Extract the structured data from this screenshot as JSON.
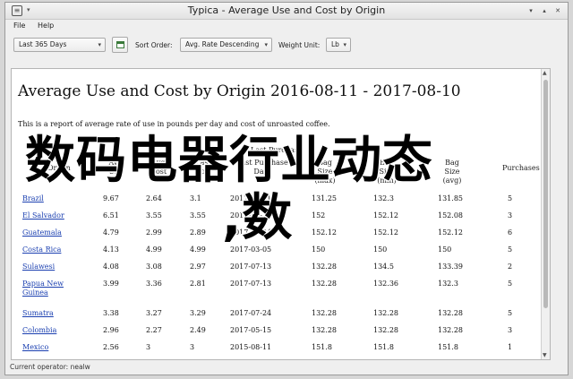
{
  "window": {
    "title": "Typica - Average Use and Cost by Origin",
    "icon": "app-icon",
    "controls": [
      "minimize-icon",
      "maximize-icon",
      "close-icon"
    ]
  },
  "menu": {
    "file": "File",
    "help": "Help"
  },
  "toolbar": {
    "date_range": "Last 365 Days",
    "sort_label": "Sort Order:",
    "sort_value": "Avg. Rate Descending",
    "weight_label": "Weight Unit:",
    "weight_value": "Lb"
  },
  "report": {
    "title": "Average Use and Cost by Origin 2016-08-11 - 2017-08-10",
    "description": "This is a report of average rate of use in pounds per day and cost of unroasted coffee.",
    "headers": {
      "origin": "Origin",
      "avg_use": "Avg Use",
      "avg_cost": "Avg Cost",
      "last_cost": "Last Cost",
      "group": "Last Purchase",
      "purchase_date": "Last Purchase Date",
      "bag_size": "Bag Size (max)",
      "bag_size_min": "Bag Size (min)",
      "bag_size_avg": "Bag Size (avg)",
      "purchases": "Purchases"
    },
    "rows": [
      {
        "origin": "Brazil",
        "use": "9.67",
        "cost": "2.64",
        "last": "3.1",
        "date": "2017-06-11",
        "max": "131.25",
        "min": "132.3",
        "avg": "131.85",
        "n": "5"
      },
      {
        "origin": "El Salvador",
        "use": "6.51",
        "cost": "3.55",
        "last": "3.55",
        "date": "2016-12-14",
        "max": "152",
        "min": "152.12",
        "avg": "152.08",
        "n": "3"
      },
      {
        "origin": "Guatemala",
        "use": "4.79",
        "cost": "2.99",
        "last": "2.89",
        "date": "2017-06-24",
        "max": "152.12",
        "min": "152.12",
        "avg": "152.12",
        "n": "6"
      },
      {
        "origin": "Costa Rica",
        "use": "4.13",
        "cost": "4.99",
        "last": "4.99",
        "date": "2017-03-05",
        "max": "150",
        "min": "150",
        "avg": "150",
        "n": "5"
      },
      {
        "origin": "Sulawesi",
        "use": "4.08",
        "cost": "3.08",
        "last": "2.97",
        "date": "2017-07-13",
        "max": "132.28",
        "min": "134.5",
        "avg": "133.39",
        "n": "2"
      },
      {
        "origin": "Papua New Guinea",
        "use": "3.99",
        "cost": "3.36",
        "last": "2.81",
        "date": "2017-07-13",
        "max": "132.28",
        "min": "132.36",
        "avg": "132.3",
        "n": "5"
      },
      {
        "origin": "Sumatra",
        "use": "3.38",
        "cost": "3.27",
        "last": "3.29",
        "date": "2017-07-24",
        "max": "132.28",
        "min": "132.28",
        "avg": "132.28",
        "n": "5"
      },
      {
        "origin": "Colombia",
        "use": "2.96",
        "cost": "2.27",
        "last": "2.49",
        "date": "2017-05-15",
        "max": "132.28",
        "min": "132.28",
        "avg": "132.28",
        "n": "3"
      },
      {
        "origin": "Mexico",
        "use": "2.56",
        "cost": "3",
        "last": "3",
        "date": "2015-08-11",
        "max": "151.8",
        "min": "151.8",
        "avg": "151.8",
        "n": "1"
      }
    ]
  },
  "overlay": {
    "line1": "数码电器行业动态",
    "line2": ",数"
  },
  "status": {
    "text": "Current operator: nealw"
  },
  "colors": {
    "link": "#1a3fb0",
    "window_bg": "#efefef"
  }
}
